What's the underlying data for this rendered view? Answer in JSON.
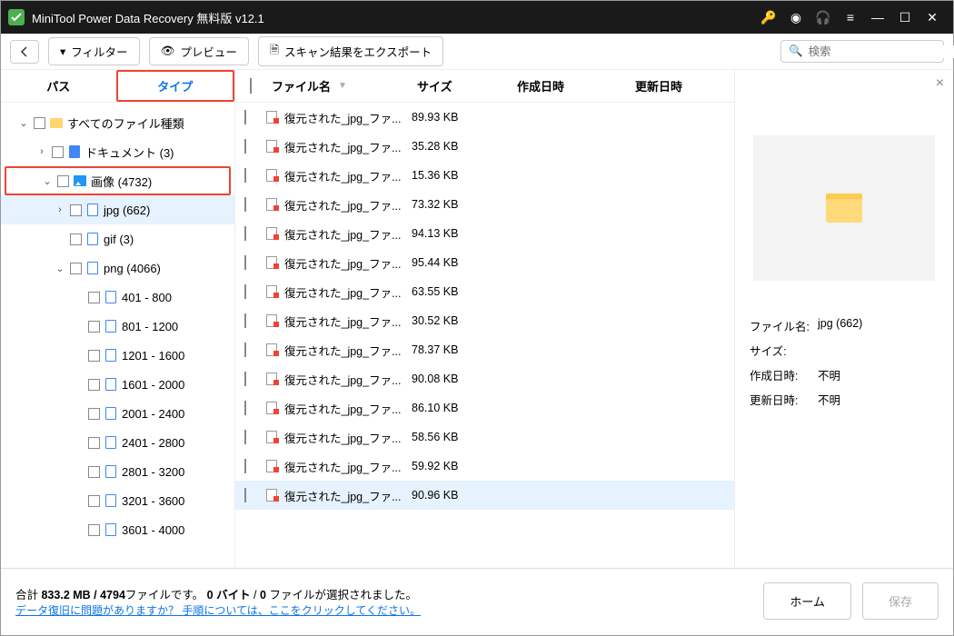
{
  "title": "MiniTool Power Data Recovery 無料版 v12.1",
  "toolbar": {
    "filter": "フィルター",
    "preview": "プレビュー",
    "export": "スキャン結果をエクスポート"
  },
  "search": {
    "placeholder": "検索"
  },
  "sidebar": {
    "tabs": {
      "path": "パス",
      "type": "タイプ"
    },
    "items": [
      {
        "label": "すべてのファイル種類",
        "indent": 0,
        "arrow": "down",
        "icon": "folder"
      },
      {
        "label": "ドキュメント (3)",
        "indent": 1,
        "arrow": "right",
        "icon": "doc"
      },
      {
        "label": "画像 (4732)",
        "indent": 1,
        "arrow": "down",
        "icon": "img",
        "redbox": true
      },
      {
        "label": "jpg (662)",
        "indent": 2,
        "arrow": "right",
        "icon": "file",
        "selected": true
      },
      {
        "label": "gif (3)",
        "indent": 2,
        "arrow": "",
        "icon": "file"
      },
      {
        "label": "png (4066)",
        "indent": 2,
        "arrow": "down",
        "icon": "file"
      },
      {
        "label": "401 - 800",
        "indent": 3,
        "arrow": "",
        "icon": "file"
      },
      {
        "label": "801 - 1200",
        "indent": 3,
        "arrow": "",
        "icon": "file"
      },
      {
        "label": "1201 - 1600",
        "indent": 3,
        "arrow": "",
        "icon": "file"
      },
      {
        "label": "1601 - 2000",
        "indent": 3,
        "arrow": "",
        "icon": "file"
      },
      {
        "label": "2001 - 2400",
        "indent": 3,
        "arrow": "",
        "icon": "file"
      },
      {
        "label": "2401 - 2800",
        "indent": 3,
        "arrow": "",
        "icon": "file"
      },
      {
        "label": "2801 - 3200",
        "indent": 3,
        "arrow": "",
        "icon": "file"
      },
      {
        "label": "3201 - 3600",
        "indent": 3,
        "arrow": "",
        "icon": "file"
      },
      {
        "label": "3601 - 4000",
        "indent": 3,
        "arrow": "",
        "icon": "file"
      }
    ]
  },
  "columns": {
    "name": "ファイル名",
    "size": "サイズ",
    "created": "作成日時",
    "modified": "更新日時"
  },
  "files": [
    {
      "name": "復元された_jpg_ファ...",
      "size": "89.93 KB"
    },
    {
      "name": "復元された_jpg_ファ...",
      "size": "35.28 KB"
    },
    {
      "name": "復元された_jpg_ファ...",
      "size": "15.36 KB"
    },
    {
      "name": "復元された_jpg_ファ...",
      "size": "73.32 KB"
    },
    {
      "name": "復元された_jpg_ファ...",
      "size": "94.13 KB"
    },
    {
      "name": "復元された_jpg_ファ...",
      "size": "95.44 KB"
    },
    {
      "name": "復元された_jpg_ファ...",
      "size": "63.55 KB"
    },
    {
      "name": "復元された_jpg_ファ...",
      "size": "30.52 KB"
    },
    {
      "name": "復元された_jpg_ファ...",
      "size": "78.37 KB"
    },
    {
      "name": "復元された_jpg_ファ...",
      "size": "90.08 KB"
    },
    {
      "name": "復元された_jpg_ファ...",
      "size": "86.10 KB"
    },
    {
      "name": "復元された_jpg_ファ...",
      "size": "58.56 KB"
    },
    {
      "name": "復元された_jpg_ファ...",
      "size": "59.92 KB"
    },
    {
      "name": "復元された_jpg_ファ...",
      "size": "90.96 KB",
      "selected": true
    }
  ],
  "preview": {
    "name_label": "ファイル名:",
    "name_value": "jpg (662)",
    "size_label": "サイズ:",
    "size_value": "",
    "created_label": "作成日時:",
    "created_value": "不明",
    "modified_label": "更新日時:",
    "modified_value": "不明"
  },
  "footer": {
    "summary_prefix": "合計 ",
    "summary_bold1": "833.2 MB / 4794",
    "summary_mid1": "ファイルです。 ",
    "summary_bold2": "0 バイト ",
    "summary_mid2": " / ",
    "summary_bold3": "0 ",
    "summary_suffix": "ファイルが選択されました。",
    "help_link": "データ復旧に問題がありますか？ 手順については、ここをクリックしてください。",
    "home": "ホーム",
    "save": "保存"
  }
}
